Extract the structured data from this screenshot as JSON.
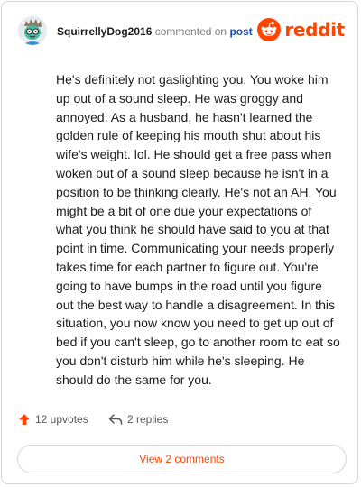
{
  "comment": {
    "username": "SquirrellyDog2016",
    "action_text": "commented on",
    "target_text": "post",
    "body": "He's definitely not gaslighting you. You woke him up out of a sound sleep. He was groggy and annoyed. As a husband, he hasn't learned the golden rule of keeping his mouth shut about his wife's weight. lol. He should get a free pass when woken out of a sound sleep because he isn't in a position to be thinking clearly. He's not an AH. You might be a bit of one due your expectations of what you think he should have said to you at that point in time. Communicating your needs properly takes time for each partner to figure out. You're going to have bumps in the road until you figure out the best way to handle a disagreement. In this situation, you now know you need to get up out of bed if you can't sleep, go to another room to eat so you don't disturb him while he's sleeping. He should do the same for you."
  },
  "brand": {
    "wordmark": "reddit",
    "color": "#ff4500"
  },
  "footer": {
    "upvotes_label": "12 upvotes",
    "replies_label": "2 replies",
    "upvote_icon": "upvote-arrow-icon",
    "reply_icon": "reply-arrow-icon"
  },
  "view_comments_label": "View 2 comments",
  "colors": {
    "accent": "#ff4500",
    "link": "#1d4fb8",
    "text": "#1c1c1c",
    "muted": "#7c7c7c",
    "border": "#d7d7d7"
  }
}
